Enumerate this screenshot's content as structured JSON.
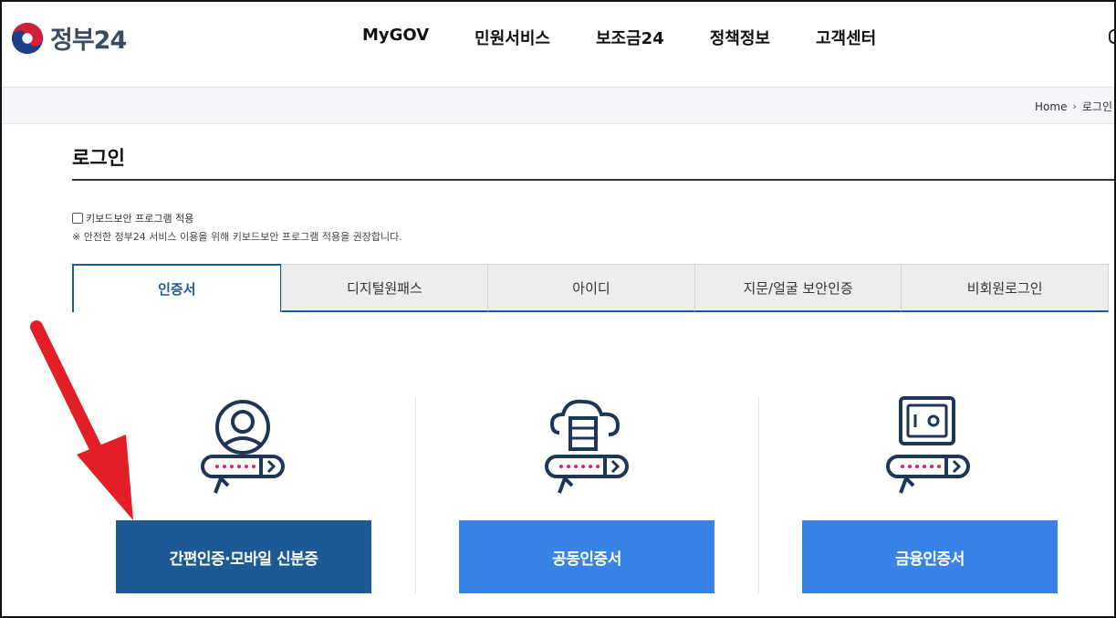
{
  "header": {
    "logo_text": "정부24",
    "nav": [
      "MyGOV",
      "민원서비스",
      "보조금24",
      "정책정보",
      "고객센터"
    ]
  },
  "breadcrumb": {
    "home": "Home",
    "separator": "›",
    "current": "로그인"
  },
  "page": {
    "title": "로그인"
  },
  "keyboard_security": {
    "label": "키보드보안 프로그램 적용",
    "checked": false,
    "note": "※ 안전한 정부24 서비스 이용을 위해 키보드보안 프로그램 적용을 권장합니다."
  },
  "tabs": [
    {
      "label": "인증서",
      "active": true
    },
    {
      "label": "디지털원패스",
      "active": false
    },
    {
      "label": "아이디",
      "active": false
    },
    {
      "label": "지문/얼굴 보안인증",
      "active": false
    },
    {
      "label": "비회원로그인",
      "active": false
    }
  ],
  "cards": [
    {
      "icon": "user-certificate-icon",
      "button_label": "간편인증·모바일 신분증",
      "button_color": "#1d5a95"
    },
    {
      "icon": "cloud-certificate-icon",
      "button_label": "공동인증서",
      "button_color": "#3884e6"
    },
    {
      "icon": "safe-certificate-icon",
      "button_label": "금융인증서",
      "button_color": "#3884e6"
    }
  ],
  "colors": {
    "brand_dark": "#1d5a95",
    "brand_light": "#3884e6",
    "arrow": "#e21e26",
    "icon_red": "#e0245e"
  }
}
